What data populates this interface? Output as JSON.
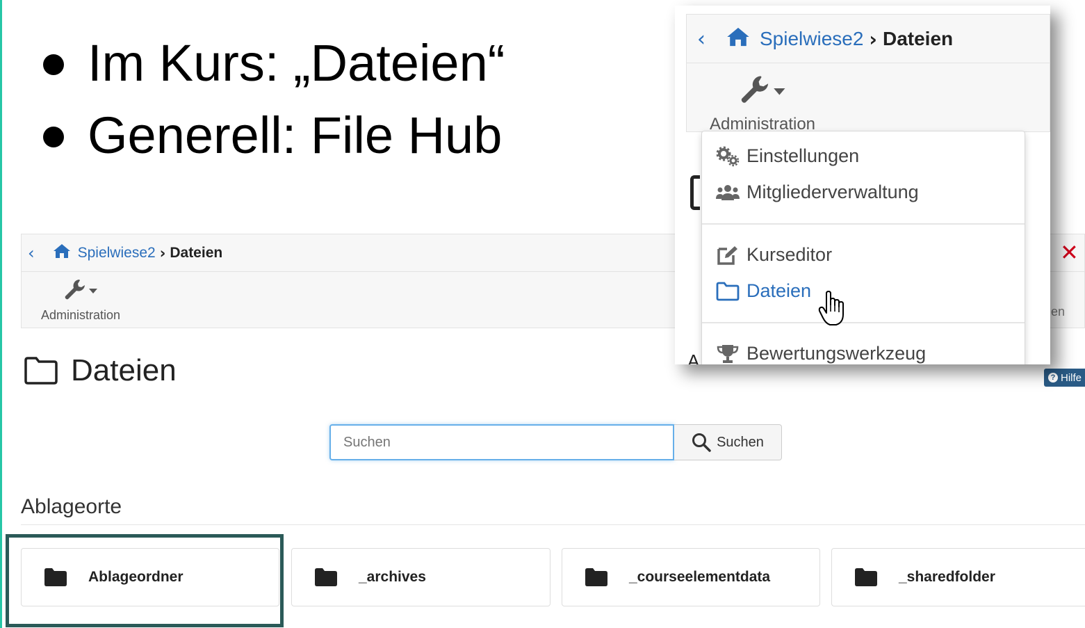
{
  "slide": {
    "bullets": [
      "Im Kurs: „Dateien“",
      "Generell: File Hub"
    ]
  },
  "course_page": {
    "breadcrumb": {
      "root": "Spielwiese2",
      "current": "Dateien"
    },
    "toolbar": {
      "admin_label": "Administration",
      "cut_label": "en",
      "help_label": "Hilfe"
    },
    "title": "Dateien",
    "search": {
      "placeholder": "Suchen",
      "button_label": "Suchen"
    },
    "section_title": "Ablageorte",
    "folders": [
      "Ablageordner",
      "_archives",
      "_courseelementdata",
      "_sharedfolder"
    ]
  },
  "zoom": {
    "breadcrumb": {
      "root": "Spielwiese2",
      "current": "Dateien"
    },
    "admin_label": "Administration",
    "side_letter": "A",
    "menu": [
      "Einstellungen",
      "Mitgliederverwaltung",
      "Kurseditor",
      "Dateien",
      "Bewertungswerkzeug"
    ]
  },
  "colors": {
    "link": "#2a6ebb",
    "highlight_box": "#2b5a58",
    "focus": "#66afe9",
    "close": "#d0021b",
    "accent": "#26c6a6"
  }
}
